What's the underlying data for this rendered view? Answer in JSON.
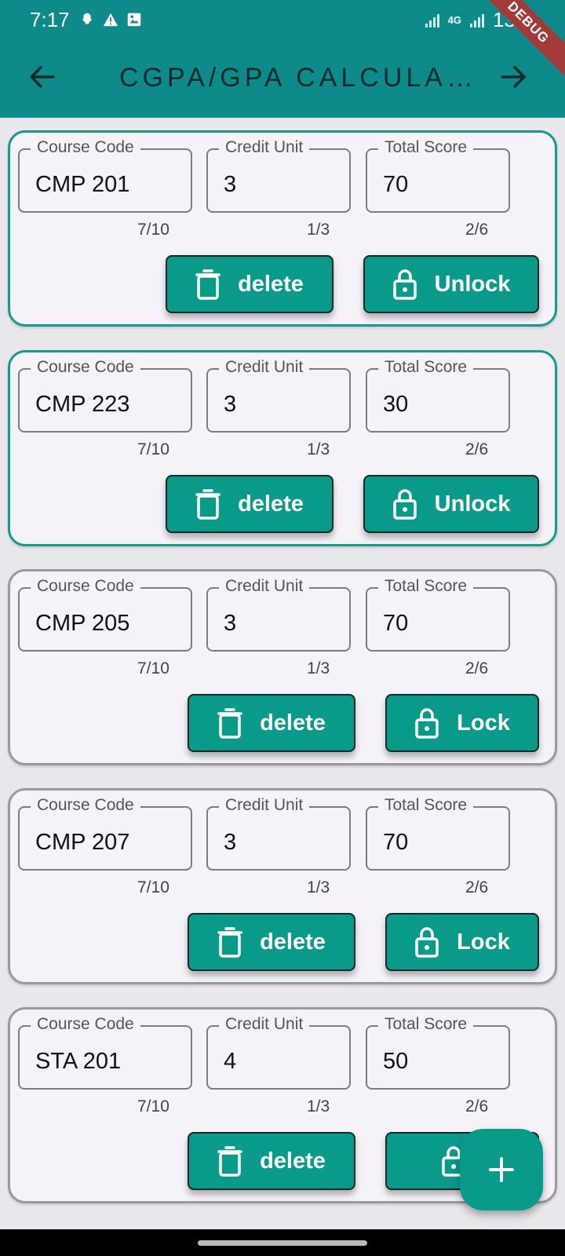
{
  "status_bar": {
    "time": "7:17",
    "battery": "13%",
    "network": "4G"
  },
  "app_bar": {
    "title": "CGPA/GPA CALCULA…"
  },
  "debug_banner": "DEBUG",
  "labels": {
    "course_code": "Course Code",
    "credit_unit": "Credit Unit",
    "total_score": "Total Score"
  },
  "courses": [
    {
      "course_code": "CMP 201",
      "credit_unit": "3",
      "total_score": "70",
      "code_counter": "7/10",
      "unit_counter": "1/3",
      "score_counter": "2/6",
      "delete_label": "delete",
      "lock_label": "Unlock"
    },
    {
      "course_code": "CMP 223",
      "credit_unit": "3",
      "total_score": "30",
      "code_counter": "7/10",
      "unit_counter": "1/3",
      "score_counter": "2/6",
      "delete_label": "delete",
      "lock_label": "Unlock"
    },
    {
      "course_code": "CMP 205",
      "credit_unit": "3",
      "total_score": "70",
      "code_counter": "7/10",
      "unit_counter": "1/3",
      "score_counter": "2/6",
      "delete_label": "delete",
      "lock_label": "Lock"
    },
    {
      "course_code": "CMP 207",
      "credit_unit": "3",
      "total_score": "70",
      "code_counter": "7/10",
      "unit_counter": "1/3",
      "score_counter": "2/6",
      "delete_label": "delete",
      "lock_label": "Lock"
    },
    {
      "course_code": "STA 201",
      "credit_unit": "4",
      "total_score": "50",
      "code_counter": "7/10",
      "unit_counter": "1/3",
      "score_counter": "2/6",
      "delete_label": "delete",
      "lock_label": ""
    }
  ],
  "colors": {
    "primary": "#0f8a8a",
    "button": "#099a8a",
    "card_bg": "#f5f2f8",
    "locked_border": "#159b8e",
    "unlocked_border": "#9a9a9a"
  },
  "icons": {
    "back": "arrow-left-icon",
    "forward": "arrow-right-icon",
    "delete": "trash-icon",
    "lock": "lock-icon",
    "add": "plus-icon"
  }
}
